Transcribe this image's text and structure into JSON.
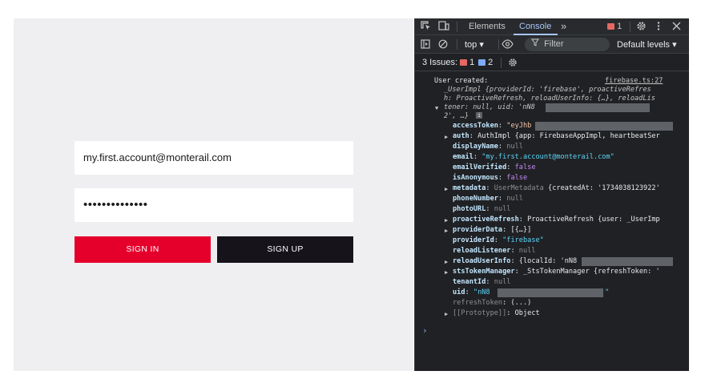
{
  "login_form": {
    "email_value": "my.first.account@monterail.com",
    "password_value": "••••••••••••••",
    "sign_in_label": "SIGN IN",
    "sign_up_label": "SIGN UP"
  },
  "devtools": {
    "tabs": [
      {
        "label": "Elements",
        "active": false
      },
      {
        "label": "Console",
        "active": true
      }
    ],
    "more_tabs_icon": "»",
    "error_count": "1",
    "context_label": "top ▾",
    "filter_placeholder": "Filter",
    "levels_label": "Default levels ▾",
    "issues_label": "3 Issues:",
    "issues_error_count": "1",
    "issues_info_count": "2",
    "icons": [
      "inspect-icon",
      "device-toolbar-icon",
      "gear-icon",
      "kebab-menu-icon",
      "close-icon",
      "sidebar-icon",
      "clear-console-icon",
      "eye-icon",
      "filter-icon"
    ],
    "colors": {
      "error": "#e46962",
      "info": "#7cacf8",
      "active_tab": "#a8c7fa"
    }
  },
  "console": {
    "log_message": "User created:",
    "source_link": "firebase.ts:27",
    "preview_line1": "_UserImpl {providerId: 'firebase', proactiveRefres",
    "preview_line2": "h: ProactiveRefresh, reloadUserInfo: {…}, reloadLis",
    "preview_line3a": "tener: null, uid: 'nN8",
    "preview_line4": "2', …}",
    "info_badge": "i",
    "props": {
      "accessToken_key": "accessToken",
      "accessToken_val": "\"eyJhb",
      "auth_key": "auth",
      "auth_val": "AuthImpl {app: FirebaseAppImpl, heartbeatSer",
      "displayName_key": "displayName",
      "displayName_val": "null",
      "email_key": "email",
      "email_val": "\"my.first.account@monterail.com\"",
      "emailVerified_key": "emailVerified",
      "emailVerified_val": "false",
      "isAnonymous_key": "isAnonymous",
      "isAnonymous_val": "false",
      "metadata_key": "metadata",
      "metadata_type": "UserMetadata",
      "metadata_val": "{createdAt: '1734038123922'",
      "phoneNumber_key": "phoneNumber",
      "phoneNumber_val": "null",
      "photoURL_key": "photoURL",
      "photoURL_val": "null",
      "proactiveRefresh_key": "proactiveRefresh",
      "proactiveRefresh_val": "ProactiveRefresh {user: _UserImp",
      "providerData_key": "providerData",
      "providerData_val": "[{…}]",
      "providerId_key": "providerId",
      "providerId_val": "\"firebase\"",
      "reloadListener_key": "reloadListener",
      "reloadListener_val": "null",
      "reloadUserInfo_key": "reloadUserInfo",
      "reloadUserInfo_val": "{localId: 'nN8",
      "stsTokenManager_key": "stsTokenManager",
      "stsTokenManager_val": "_StsTokenManager {refreshToken: '",
      "tenantId_key": "tenantId",
      "tenantId_val": "null",
      "uid_key": "uid",
      "uid_val": "\"nN8",
      "uid_end": "\"",
      "refreshToken_key": "refreshToken",
      "refreshToken_val": "(...)",
      "prototype_key": "[[Prototype]]",
      "prototype_val": "Object"
    },
    "prompt_symbol": "›"
  }
}
